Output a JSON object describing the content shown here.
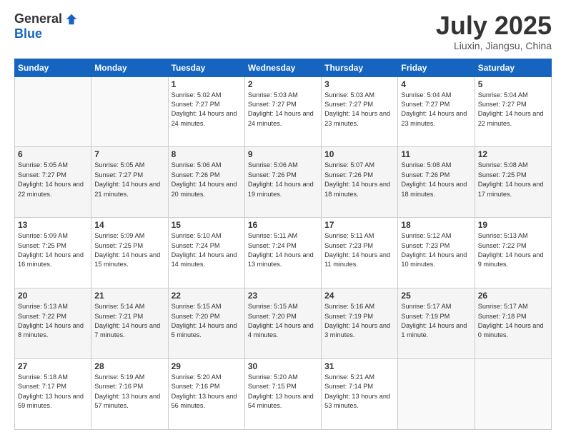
{
  "logo": {
    "general": "General",
    "blue": "Blue"
  },
  "title": "July 2025",
  "location": "Liuxin, Jiangsu, China",
  "days_of_week": [
    "Sunday",
    "Monday",
    "Tuesday",
    "Wednesday",
    "Thursday",
    "Friday",
    "Saturday"
  ],
  "weeks": [
    [
      {
        "empty": true
      },
      {
        "empty": true
      },
      {
        "day": 1,
        "sunrise": "5:02 AM",
        "sunset": "7:27 PM",
        "daylight": "14 hours and 24 minutes."
      },
      {
        "day": 2,
        "sunrise": "5:03 AM",
        "sunset": "7:27 PM",
        "daylight": "14 hours and 24 minutes."
      },
      {
        "day": 3,
        "sunrise": "5:03 AM",
        "sunset": "7:27 PM",
        "daylight": "14 hours and 23 minutes."
      },
      {
        "day": 4,
        "sunrise": "5:04 AM",
        "sunset": "7:27 PM",
        "daylight": "14 hours and 23 minutes."
      },
      {
        "day": 5,
        "sunrise": "5:04 AM",
        "sunset": "7:27 PM",
        "daylight": "14 hours and 22 minutes."
      }
    ],
    [
      {
        "day": 6,
        "sunrise": "5:05 AM",
        "sunset": "7:27 PM",
        "daylight": "14 hours and 22 minutes."
      },
      {
        "day": 7,
        "sunrise": "5:05 AM",
        "sunset": "7:27 PM",
        "daylight": "14 hours and 21 minutes."
      },
      {
        "day": 8,
        "sunrise": "5:06 AM",
        "sunset": "7:26 PM",
        "daylight": "14 hours and 20 minutes."
      },
      {
        "day": 9,
        "sunrise": "5:06 AM",
        "sunset": "7:26 PM",
        "daylight": "14 hours and 19 minutes."
      },
      {
        "day": 10,
        "sunrise": "5:07 AM",
        "sunset": "7:26 PM",
        "daylight": "14 hours and 18 minutes."
      },
      {
        "day": 11,
        "sunrise": "5:08 AM",
        "sunset": "7:26 PM",
        "daylight": "14 hours and 18 minutes."
      },
      {
        "day": 12,
        "sunrise": "5:08 AM",
        "sunset": "7:25 PM",
        "daylight": "14 hours and 17 minutes."
      }
    ],
    [
      {
        "day": 13,
        "sunrise": "5:09 AM",
        "sunset": "7:25 PM",
        "daylight": "14 hours and 16 minutes."
      },
      {
        "day": 14,
        "sunrise": "5:09 AM",
        "sunset": "7:25 PM",
        "daylight": "14 hours and 15 minutes."
      },
      {
        "day": 15,
        "sunrise": "5:10 AM",
        "sunset": "7:24 PM",
        "daylight": "14 hours and 14 minutes."
      },
      {
        "day": 16,
        "sunrise": "5:11 AM",
        "sunset": "7:24 PM",
        "daylight": "14 hours and 13 minutes."
      },
      {
        "day": 17,
        "sunrise": "5:11 AM",
        "sunset": "7:23 PM",
        "daylight": "14 hours and 11 minutes."
      },
      {
        "day": 18,
        "sunrise": "5:12 AM",
        "sunset": "7:23 PM",
        "daylight": "14 hours and 10 minutes."
      },
      {
        "day": 19,
        "sunrise": "5:13 AM",
        "sunset": "7:22 PM",
        "daylight": "14 hours and 9 minutes."
      }
    ],
    [
      {
        "day": 20,
        "sunrise": "5:13 AM",
        "sunset": "7:22 PM",
        "daylight": "14 hours and 8 minutes."
      },
      {
        "day": 21,
        "sunrise": "5:14 AM",
        "sunset": "7:21 PM",
        "daylight": "14 hours and 7 minutes."
      },
      {
        "day": 22,
        "sunrise": "5:15 AM",
        "sunset": "7:20 PM",
        "daylight": "14 hours and 5 minutes."
      },
      {
        "day": 23,
        "sunrise": "5:15 AM",
        "sunset": "7:20 PM",
        "daylight": "14 hours and 4 minutes."
      },
      {
        "day": 24,
        "sunrise": "5:16 AM",
        "sunset": "7:19 PM",
        "daylight": "14 hours and 3 minutes."
      },
      {
        "day": 25,
        "sunrise": "5:17 AM",
        "sunset": "7:19 PM",
        "daylight": "14 hours and 1 minute."
      },
      {
        "day": 26,
        "sunrise": "5:17 AM",
        "sunset": "7:18 PM",
        "daylight": "14 hours and 0 minutes."
      }
    ],
    [
      {
        "day": 27,
        "sunrise": "5:18 AM",
        "sunset": "7:17 PM",
        "daylight": "13 hours and 59 minutes."
      },
      {
        "day": 28,
        "sunrise": "5:19 AM",
        "sunset": "7:16 PM",
        "daylight": "13 hours and 57 minutes."
      },
      {
        "day": 29,
        "sunrise": "5:20 AM",
        "sunset": "7:16 PM",
        "daylight": "13 hours and 56 minutes."
      },
      {
        "day": 30,
        "sunrise": "5:20 AM",
        "sunset": "7:15 PM",
        "daylight": "13 hours and 54 minutes."
      },
      {
        "day": 31,
        "sunrise": "5:21 AM",
        "sunset": "7:14 PM",
        "daylight": "13 hours and 53 minutes."
      },
      {
        "empty": true
      },
      {
        "empty": true
      }
    ]
  ]
}
